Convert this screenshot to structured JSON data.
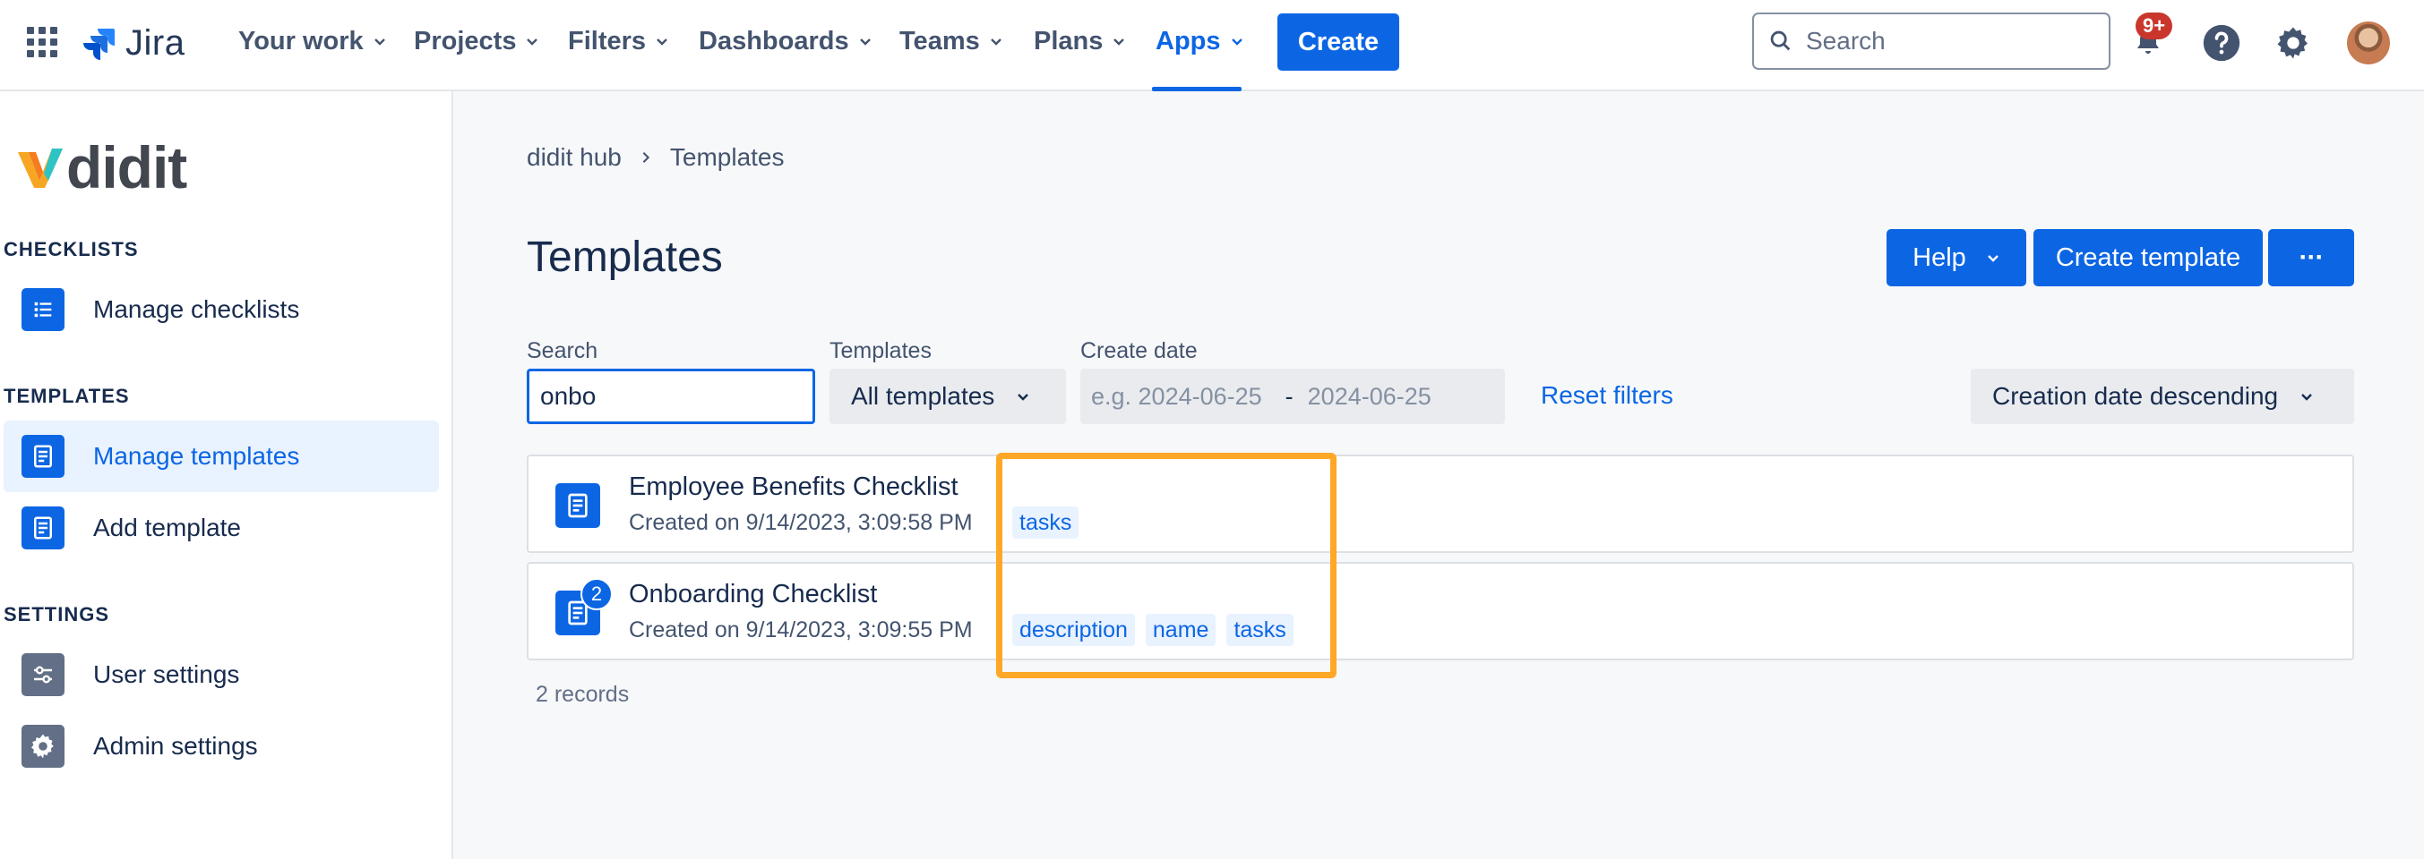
{
  "topnav": {
    "app_name": "Jira",
    "items": [
      {
        "label": "Your work"
      },
      {
        "label": "Projects"
      },
      {
        "label": "Filters"
      },
      {
        "label": "Dashboards"
      },
      {
        "label": "Teams"
      },
      {
        "label": "Plans"
      },
      {
        "label": "Apps"
      }
    ],
    "active_item": "Apps",
    "create_label": "Create",
    "search_placeholder": "Search",
    "notification_badge": "9+",
    "icons": [
      "app-switcher-icon",
      "bell-icon",
      "help-icon",
      "gear-icon"
    ]
  },
  "sidebar": {
    "brand": "didit",
    "sections": [
      {
        "title": "CHECKLISTS",
        "items": [
          {
            "label": "Manage checklists",
            "icon": "list-icon"
          }
        ]
      },
      {
        "title": "TEMPLATES",
        "items": [
          {
            "label": "Manage templates",
            "icon": "template-icon",
            "selected": true
          },
          {
            "label": "Add template",
            "icon": "template-icon"
          }
        ]
      },
      {
        "title": "SETTINGS",
        "items": [
          {
            "label": "User settings",
            "icon": "sliders-icon"
          },
          {
            "label": "Admin settings",
            "icon": "gear-icon"
          }
        ]
      }
    ]
  },
  "main": {
    "breadcrumb": [
      "didit hub",
      "Templates"
    ],
    "title": "Templates",
    "actions": {
      "help": "Help",
      "create_template": "Create template",
      "more": "···"
    },
    "filters": {
      "search_label": "Search",
      "search_value": "onbo",
      "templates_label": "Templates",
      "templates_value": "All templates",
      "date_label": "Create date",
      "date_from_placeholder": "e.g. 2024-06-25",
      "date_separator": "-",
      "date_to_placeholder": "2024-06-25",
      "reset": "Reset filters",
      "sort_value": "Creation date descending"
    },
    "rows": [
      {
        "name": "Employee Benefits Checklist",
        "created": "Created on 9/14/2023, 3:09:58 PM",
        "tags": [
          "tasks"
        ],
        "count": ""
      },
      {
        "name": "Onboarding Checklist",
        "created": "Created on 9/14/2023, 3:09:55 PM",
        "tags": [
          "description",
          "name",
          "tasks"
        ],
        "count": "2"
      }
    ],
    "records": "2 records"
  },
  "colors": {
    "accent": "#0c66e4",
    "highlight": "#ffa726",
    "badge": "#c9372c"
  }
}
